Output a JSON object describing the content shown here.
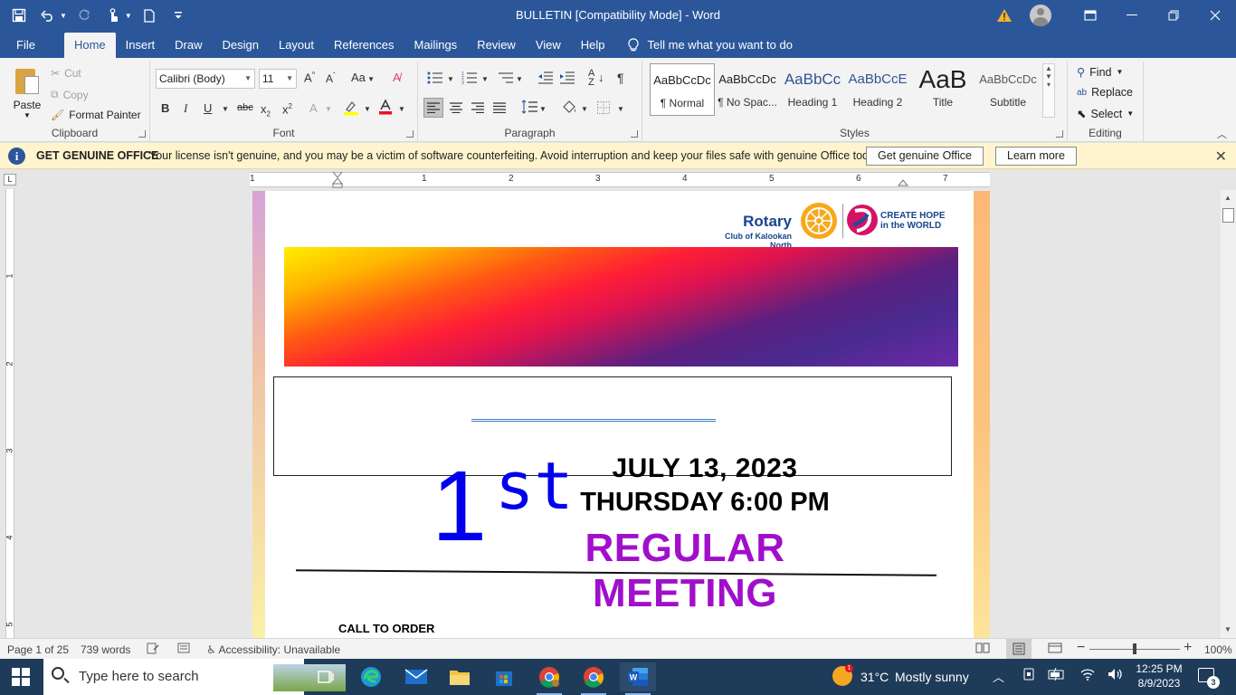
{
  "window": {
    "title": "BULLETIN [Compatibility Mode]  -  Word"
  },
  "ribbon_tabs": [
    "File",
    "Home",
    "Insert",
    "Draw",
    "Design",
    "Layout",
    "References",
    "Mailings",
    "Review",
    "View",
    "Help"
  ],
  "tell_me": "Tell me what you want to do",
  "clipboard": {
    "paste": "Paste",
    "cut": "Cut",
    "copy": "Copy",
    "format_painter": "Format Painter",
    "label": "Clipboard"
  },
  "font": {
    "name": "Calibri (Body)",
    "size": "11",
    "label": "Font"
  },
  "paragraph": {
    "label": "Paragraph"
  },
  "styles": {
    "label": "Styles",
    "items": [
      {
        "preview": "AaBbCcDc",
        "name": "¶ Normal"
      },
      {
        "preview": "AaBbCcDc",
        "name": "¶ No Spac..."
      },
      {
        "preview": "AaBbCc",
        "name": "Heading 1"
      },
      {
        "preview": "AaBbCcE",
        "name": "Heading 2"
      },
      {
        "preview": "AaB",
        "name": "Title"
      },
      {
        "preview": "AaBbCcDc",
        "name": "Subtitle"
      }
    ]
  },
  "editing": {
    "find": "Find",
    "replace": "Replace",
    "select": "Select",
    "label": "Editing"
  },
  "message_bar": {
    "title": "GET GENUINE OFFICE",
    "text": "Your license isn't genuine, and you may be a victim of software counterfeiting. Avoid interruption and keep your files safe with genuine Office today.",
    "button_primary": "Get genuine Office",
    "button_secondary": "Learn more"
  },
  "ruler": {
    "numbers": [
      "1",
      "1",
      "2",
      "3",
      "4",
      "5",
      "6",
      "7"
    ],
    "vertical_numbers": [
      "1",
      "2",
      "3",
      "4",
      "5"
    ],
    "tab_selector": "L"
  },
  "document": {
    "logo": {
      "name": "Rotary",
      "club": "Club of Kalookan North",
      "slogan_line1": "CREATE HOPE",
      "slogan_line2": "in the WORLD"
    },
    "ordinal_number": "1",
    "ordinal_suffix": "st",
    "date": "JULY 13, 2023",
    "time": "THURSDAY 6:00 PM",
    "meeting_title": "REGULAR MEETING",
    "first_heading": "CALL TO ORDER"
  },
  "status": {
    "page": "Page 1 of 25",
    "words": "739 words",
    "accessibility": "Accessibility: Unavailable",
    "zoom": "100%",
    "zoom_level": 1.0
  },
  "taskbar": {
    "search_placeholder": "Type here to search",
    "weather_temp": "31°C",
    "weather_condition": "Mostly sunny",
    "weather_badge": "1",
    "time": "12:25 PM",
    "date": "8/9/2023",
    "notification_count": "3"
  },
  "colors": {
    "word_blue": "#2b579a",
    "ordinal_blue": "#0000ee",
    "meeting_purple": "#a10fcb",
    "rotary_blue": "#17458f",
    "rotary_gold": "#f7a81b"
  }
}
